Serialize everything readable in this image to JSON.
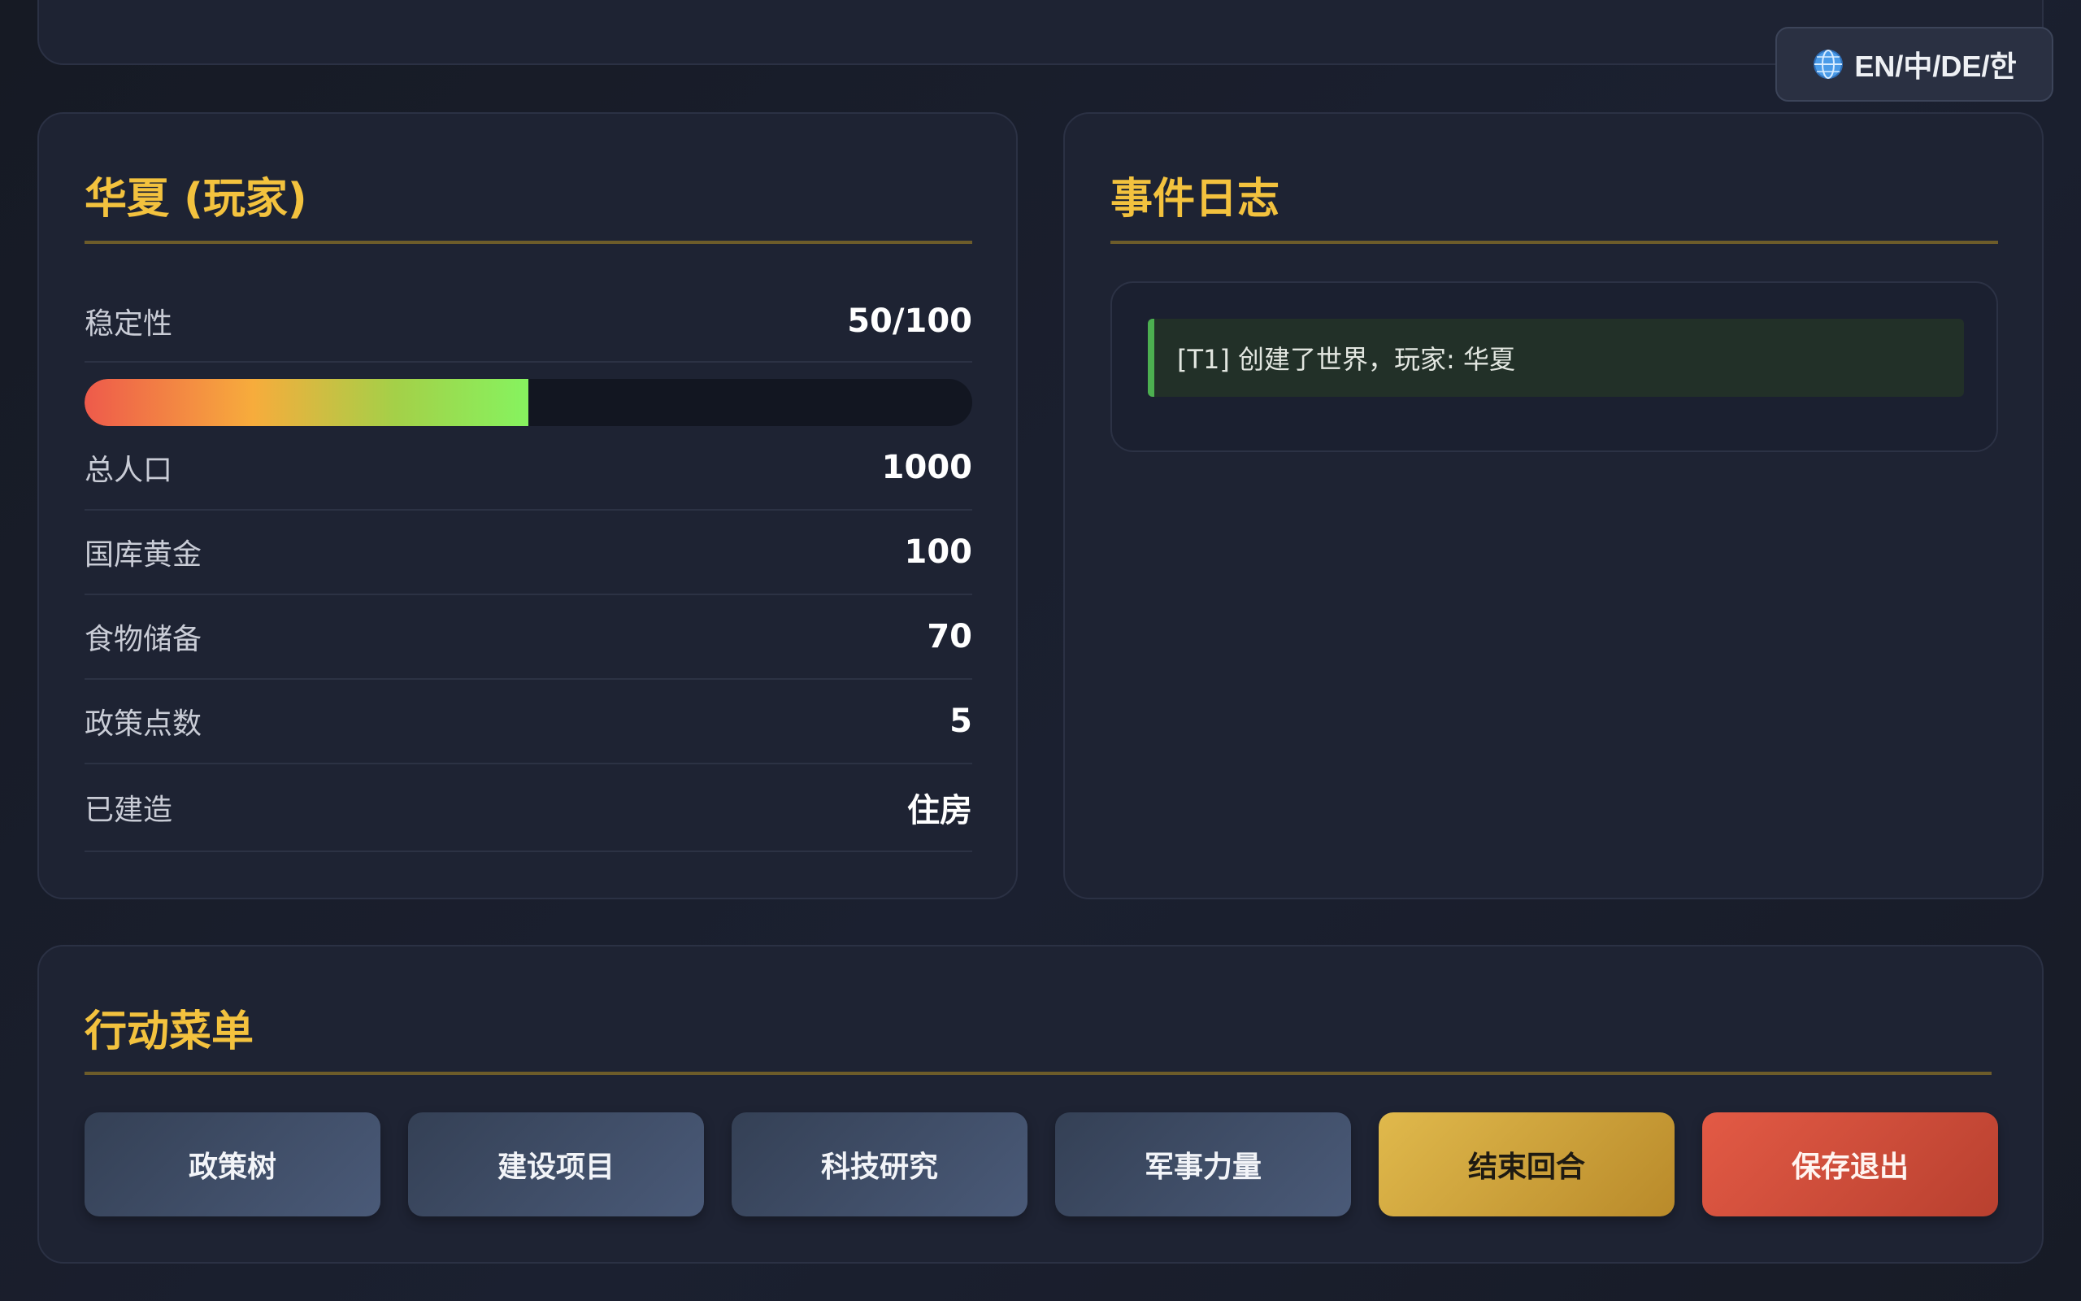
{
  "language_switcher": {
    "label": "EN/中/DE/한",
    "icon": "globe-icon"
  },
  "nation": {
    "title": "华夏 (玩家)",
    "stability": {
      "label": "稳定性",
      "value": "50/100",
      "fraction": 0.5
    },
    "stats": [
      {
        "label": "总人口",
        "value": "1000"
      },
      {
        "label": "国库黄金",
        "value": "100"
      },
      {
        "label": "食物储备",
        "value": "70"
      },
      {
        "label": "政策点数",
        "value": "5"
      },
      {
        "label": "已建造",
        "value": "住房"
      }
    ]
  },
  "event_log": {
    "title": "事件日志",
    "entries": [
      "[T1] 创建了世界，玩家: 华夏"
    ]
  },
  "actions": {
    "title": "行动菜单",
    "buttons": [
      {
        "label": "政策树"
      },
      {
        "label": "建设项目"
      },
      {
        "label": "科技研究"
      },
      {
        "label": "军事力量"
      },
      {
        "label": "结束回合"
      },
      {
        "label": "保存退出"
      }
    ]
  },
  "colors": {
    "accent_gold": "#f3c23e",
    "log_border_green": "#4caf50",
    "end_turn_gold": "#d4a73f",
    "save_exit_red": "#d64e3c"
  }
}
